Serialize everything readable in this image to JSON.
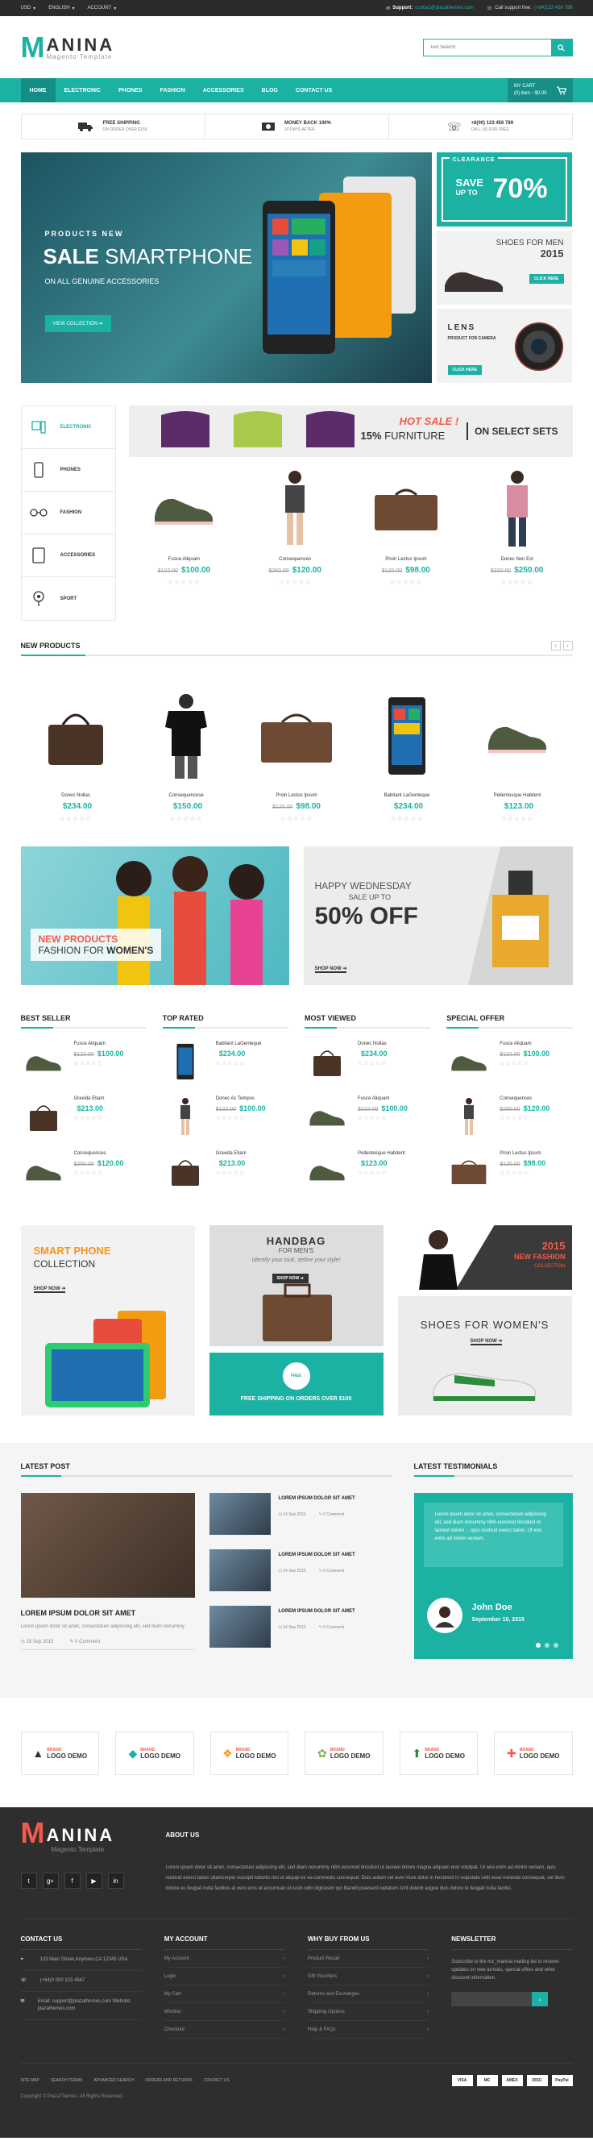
{
  "topbar": {
    "currency": "USD",
    "language": "ENGLISH",
    "account": "ACCOUNT",
    "support_label": "Support:",
    "support_email": "contact@plazathemes.com",
    "call_label": "Call support free:",
    "call_phone": "(+84)123 456 789"
  },
  "header": {
    "logo_m": "M",
    "logo_name": "ANINA",
    "logo_sub": "Magento Template",
    "search_placeholder": "Text Search"
  },
  "nav": {
    "items": [
      "HOME",
      "ELECTRONIC",
      "PHONES",
      "FASHION",
      "ACCESSORIES",
      "BLOG",
      "CONTACT US"
    ],
    "cart_title": "MY CART",
    "cart_summary": "(0) item - $0.00"
  },
  "features": [
    {
      "title": "FREE SHIPPING",
      "sub": "ON ORDER OVER $150"
    },
    {
      "title": "MONEY BACK 100%",
      "sub": "30 DAYS AFTER"
    },
    {
      "title": "+8(00) 123 456 789",
      "sub": "CALL US FOR FREE"
    }
  ],
  "hero": {
    "products_new": "PRODUCTS NEW",
    "sale_bold": "SALE",
    "sale_rest": " SMARTPHONE",
    "sub": "ON ALL GENUINE ACCESSORIES",
    "button": "VIEW COLLECTION"
  },
  "side_banners": {
    "clearance": "CLEARANCE",
    "save": "SAVE",
    "up_to": "UP TO",
    "percent": "70%",
    "shoes_title": "SHOES FOR MEN",
    "shoes_year": "2015",
    "click_here": "CLICK HERE",
    "lens_title": "LENS",
    "lens_sub": "PRODUCT FOR CAMERA",
    "click_here2": "CLICK HERE"
  },
  "categories": [
    "ELECTRONIC",
    "PHONES",
    "FASHION",
    "ACCESSORIES",
    "SPORT"
  ],
  "hot_banner": {
    "hot": "HOT SALE !",
    "pct": "15%",
    "furniture": " FURNITURE",
    "on_select": "ON SELECT SETS"
  },
  "cat_products": [
    {
      "name": "Fusce Aliquam",
      "old": "$122.00",
      "price": "$100.00"
    },
    {
      "name": "Consequences",
      "old": "$250.00",
      "price": "$120.00"
    },
    {
      "name": "Proin Lectus Ipsum",
      "old": "$120.00",
      "price": "$98.00"
    },
    {
      "name": "Donec Non Est",
      "old": "$220.00",
      "price": "$250.00"
    }
  ],
  "new_products": {
    "title": "NEW PRODUCTS",
    "items": [
      {
        "name": "Donec Nollas",
        "old": "",
        "price": "$234.00"
      },
      {
        "name": "Consequencese",
        "old": "",
        "price": "$150.00"
      },
      {
        "name": "Proin Lectus Ipsum",
        "old": "$120.00",
        "price": "$98.00"
      },
      {
        "name": "Babitant LaGenteque",
        "old": "",
        "price": "$234.00"
      },
      {
        "name": "Pellentesque Habitent",
        "old": "",
        "price": "$123.00"
      }
    ]
  },
  "promo": {
    "new_products": "NEW PRODUCTS",
    "fashion_for": "FASHION FOR ",
    "women": "WOMEN'S",
    "happy": "HAPPY WEDNESDAY",
    "sale_up": "SALE UP TO",
    "off": "50% OFF",
    "shop_now": "SHOP NOW"
  },
  "lists": [
    {
      "title": "BEST SELLER",
      "items": [
        {
          "name": "Fusce Aliquam",
          "old": "$122.00",
          "price": "$100.00"
        },
        {
          "name": "Gravida Etiam",
          "old": "",
          "price": "$213.00"
        },
        {
          "name": "Consequences",
          "old": "$250.00",
          "price": "$120.00"
        }
      ]
    },
    {
      "title": "TOP RATED",
      "items": [
        {
          "name": "Babitant LaGenteque",
          "old": "",
          "price": "$234.00"
        },
        {
          "name": "Donec Ac Tempus",
          "old": "$122.00",
          "price": "$100.00"
        },
        {
          "name": "Gravida Etiam",
          "old": "",
          "price": "$213.00"
        }
      ]
    },
    {
      "title": "MOST VIEWED",
      "items": [
        {
          "name": "Donec Nollas",
          "old": "",
          "price": "$234.00"
        },
        {
          "name": "Fusce Aliquam",
          "old": "$122.00",
          "price": "$100.00"
        },
        {
          "name": "Pellentesque Habitent",
          "old": "",
          "price": "$123.00"
        }
      ]
    },
    {
      "title": "SPECIAL OFFER",
      "items": [
        {
          "name": "Fusce Aliquam",
          "old": "$122.00",
          "price": "$100.00"
        },
        {
          "name": "Consequences",
          "old": "$250.00",
          "price": "$120.00"
        },
        {
          "name": "Proin Lectus Ipsum",
          "old": "$120.00",
          "price": "$98.00"
        }
      ]
    }
  ],
  "grid_banners": {
    "smart_phone": "SMART PHONE",
    "collection": "COLLECTION",
    "shop_now": "SHOP NOW",
    "handbag": "HANDBAG",
    "for_men": "FOR MEN'S",
    "identify": "Identify your look, define your style!",
    "shop_now2": "SHOP NOW",
    "free": "FREE",
    "free_shipping": "FREE SHIPPING ON ORDERS OVER $100",
    "year": "2015",
    "new_fashion": "NEW FASHION",
    "collection2": "COLLECTION",
    "shoes_women": "SHOES FOR WOMEN'S",
    "shop_now3": "SHOP NOW"
  },
  "blog": {
    "title": "LATEST POST",
    "main_title": "LOREM IPSUM DOLOR SIT AMET",
    "main_text": "Lorem ipsum dolor sit amet, consectetuer adipiscing elit, sed diam nonummy",
    "main_date": "15 Sep 2015",
    "main_comments": "0 Comment",
    "side": [
      {
        "title": "LOREM IPSUM DOLOR SIT AMET",
        "date": "14 Sep 2015",
        "comments": "0 Comment"
      },
      {
        "title": "LOREM IPSUM DOLOR SIT AMET",
        "date": "14 Sep 2015",
        "comments": "0 Comment"
      },
      {
        "title": "LOREM IPSUM DOLOR SIT AMET",
        "date": "14 Sep 2015",
        "comments": "0 Comment"
      }
    ]
  },
  "testimonials": {
    "title": "LATEST TESTIMONIALS",
    "quote": "Lorem ipsum dolor sit amet, consectetuer adipiscing elit, sed diam nonummy nibh euismod tincidunt ut laoreet dolore ... quis nostrud exerci tation. Ut wisi enim ad minim veniam.",
    "name": "John Doe",
    "date": "September 10, 2015"
  },
  "brands": [
    {
      "tag": "BRAND",
      "name": "LOGO DEMO",
      "icon": "▲"
    },
    {
      "tag": "BRAND",
      "name": "LOGO DEMO",
      "icon": "◆"
    },
    {
      "tag": "BRAND",
      "name": "LOGO DEMO",
      "icon": "❖"
    },
    {
      "tag": "BRAND",
      "name": "LOGO DEMO",
      "icon": "✿"
    },
    {
      "tag": "BRAND",
      "name": "LOGO DEMO",
      "icon": "⬆"
    },
    {
      "tag": "BRAND",
      "name": "LOGO DEMO",
      "icon": "✚"
    }
  ],
  "footer": {
    "logo_m": "M",
    "logo_name": "ANINA",
    "logo_sub": "Magento Template",
    "about_title": "ABOUT US",
    "about_text": "Lorem ipsum dolor sit amet, consectetuer adipiscing elit, sed diam nonummy nibh euismod tincidunt ut laoreet dolore magna aliquam erat volutpat. Ut wisi enim ad minim veniam, quis nostrud exerci tation ullamcorper suscipit lobortis nisl ut aliquip ex ea commodo consequat. Duis autem vel eum iriure dolor in hendrerit in vulputate velit esse molestie consequat, vel illum dolore eu feugiat nulla facilisis at vero eros et accumsan et iusto odio dignissim qui blandit praesent luptatum zzril delenit augue duis dolore te feugait nulla facilisi.",
    "contact_title": "CONTACT US",
    "contact": [
      "123 Main Street,Anytown,CA 12345 USA.",
      "(+84)0 000 123 4567",
      "Email: support@plazathemes.com Website: plazathemes.com"
    ],
    "account_title": "MY ACCOUNT",
    "account": [
      "My Account",
      "Login",
      "My Cart",
      "Wishlist",
      "Checkout"
    ],
    "why_title": "WHY BUY FROM US",
    "why": [
      "Product Recall",
      "Gift Vouchers",
      "Returns and Exchanges",
      "Shipping Options",
      "Help & FAQs"
    ],
    "news_title": "NEWSLETTER",
    "news_text": "Subscribe to the mz_manina mailing list to receive updates on new arrivals, special offers and other discount information.",
    "links": [
      "SITE MAP",
      "SEARCH TERMS",
      "ADVANCED SEARCH",
      "ORDERS AND RETURNS",
      "CONTACT US"
    ],
    "payments": [
      "VISA",
      "MC",
      "AMEX",
      "DISC",
      "PayPal"
    ],
    "copyright": "Copyright © PlazaThemes. All Rights Reserved."
  },
  "colors": {
    "accent": "#1bb2a4",
    "sale": "#f25a4a",
    "dark": "#2e2e2e"
  }
}
